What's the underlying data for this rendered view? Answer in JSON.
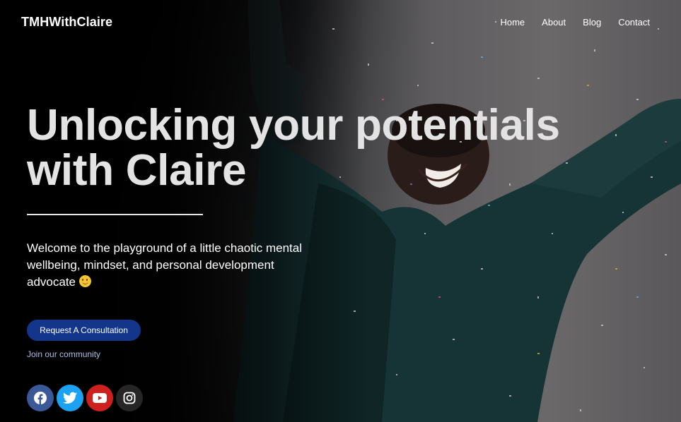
{
  "nav": {
    "brand": "TMHWithClaire",
    "links": [
      "Home",
      "About",
      "Blog",
      "Contact"
    ]
  },
  "hero": {
    "headline_line1": "Unlocking your potentials",
    "headline_line2": "with Claire",
    "intro": "Welcome to the playground of a little chaotic mental wellbeing, mindset, and personal development advocate",
    "cta_label": "Request A Consultation",
    "join_label": "Join our community"
  },
  "socials": [
    "facebook-icon",
    "twitter-icon",
    "youtube-icon",
    "instagram-icon"
  ],
  "colors": {
    "cta": "#13358c",
    "facebook": "#3b5998",
    "twitter": "#1da1f2",
    "youtube": "#cd201f",
    "instagram": "#262626"
  }
}
